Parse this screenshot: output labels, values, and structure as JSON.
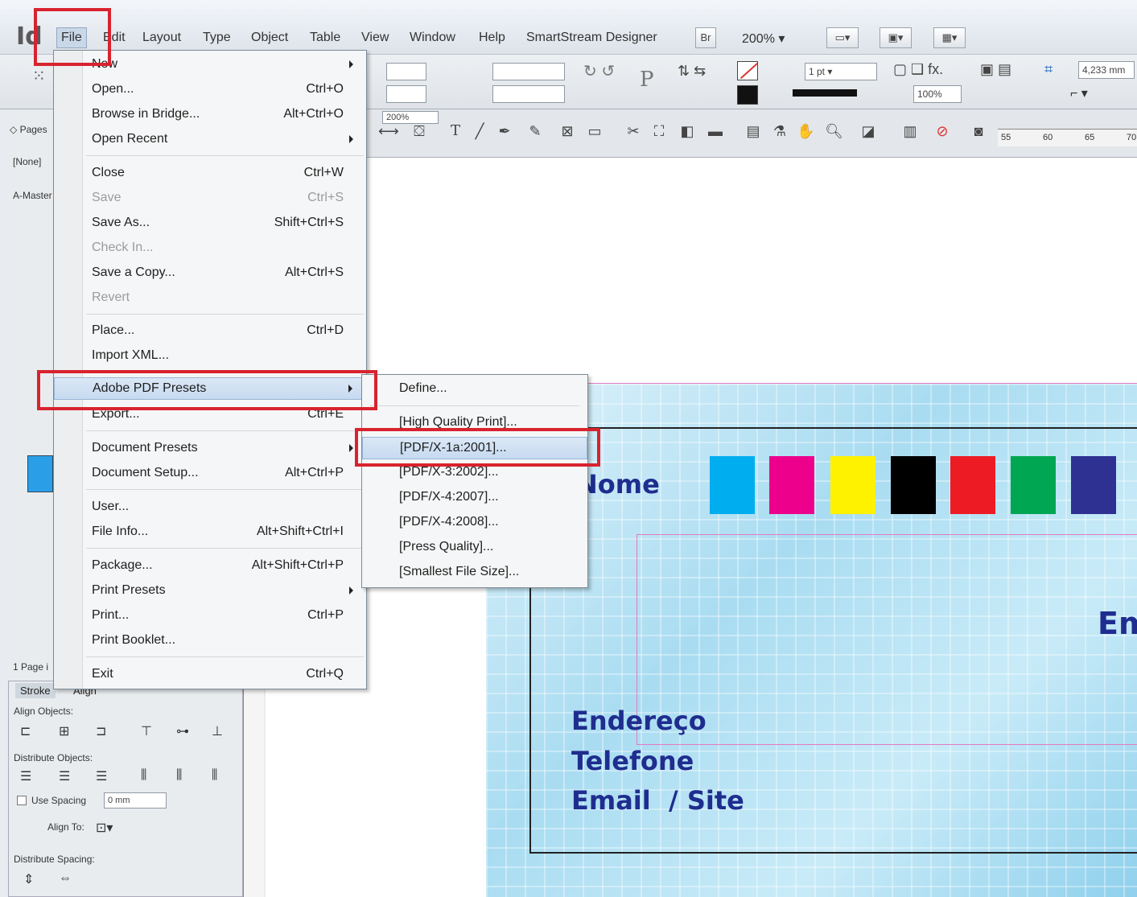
{
  "app": {
    "logo": "Id"
  },
  "menubar": {
    "items": [
      "File",
      "Edit",
      "Layout",
      "Type",
      "Object",
      "Table",
      "View",
      "Window",
      "Help",
      "SmartStream Designer"
    ],
    "bridge_btn": "Br",
    "zoom": "200%"
  },
  "control_bar": {
    "stroke_weight": "1 pt",
    "opacity": "100%",
    "size_value": "4,233 mm",
    "zoom_field": "200%"
  },
  "rulers": {
    "h_ticks": [
      "55",
      "60",
      "65",
      "70"
    ]
  },
  "pages_panel": {
    "tab": "Pages",
    "none_label": "[None]",
    "master_label": "A-Master",
    "footer": "1 Page i"
  },
  "align_panel": {
    "tab_stroke": "Stroke",
    "tab_align": "Align",
    "align_objects": "Align Objects:",
    "distribute_objects": "Distribute Objects:",
    "use_spacing": "Use Spacing",
    "spacing_value": "0 mm",
    "align_to": "Align To:",
    "distribute_spacing": "Distribute Spacing:"
  },
  "file_menu": {
    "items": [
      {
        "label": "New",
        "shortcut": "",
        "submenu": true
      },
      {
        "label": "Open...",
        "shortcut": "Ctrl+O"
      },
      {
        "label": "Browse in Bridge...",
        "shortcut": "Alt+Ctrl+O"
      },
      {
        "label": "Open Recent",
        "shortcut": "",
        "submenu": true
      },
      {
        "label": "Close",
        "shortcut": "Ctrl+W"
      },
      {
        "label": "Save",
        "shortcut": "Ctrl+S",
        "disabled": true
      },
      {
        "label": "Save As...",
        "shortcut": "Shift+Ctrl+S"
      },
      {
        "label": "Check In...",
        "shortcut": "",
        "disabled": true
      },
      {
        "label": "Save a Copy...",
        "shortcut": "Alt+Ctrl+S"
      },
      {
        "label": "Revert",
        "shortcut": "",
        "disabled": true
      },
      {
        "label": "Place...",
        "shortcut": "Ctrl+D"
      },
      {
        "label": "Import XML...",
        "shortcut": ""
      },
      {
        "label": "Adobe PDF Presets",
        "shortcut": "",
        "submenu": true,
        "highlighted": true
      },
      {
        "label": "Export...",
        "shortcut": "Ctrl+E"
      },
      {
        "label": "Document Presets",
        "shortcut": "",
        "submenu": true
      },
      {
        "label": "Document Setup...",
        "shortcut": "Alt+Ctrl+P"
      },
      {
        "label": "User...",
        "shortcut": ""
      },
      {
        "label": "File Info...",
        "shortcut": "Alt+Shift+Ctrl+I"
      },
      {
        "label": "Package...",
        "shortcut": "Alt+Shift+Ctrl+P"
      },
      {
        "label": "Print Presets",
        "shortcut": "",
        "submenu": true
      },
      {
        "label": "Print...",
        "shortcut": "Ctrl+P"
      },
      {
        "label": "Print Booklet...",
        "shortcut": ""
      },
      {
        "label": "Exit",
        "shortcut": "Ctrl+Q"
      }
    ]
  },
  "pdf_presets_submenu": {
    "items": [
      {
        "label": "Define..."
      },
      {
        "label": "[High Quality Print]..."
      },
      {
        "label": "[PDF/X-1a:2001]...",
        "highlighted": true
      },
      {
        "label": "[PDF/X-3:2002]..."
      },
      {
        "label": "[PDF/X-4:2007]..."
      },
      {
        "label": "[PDF/X-4:2008]..."
      },
      {
        "label": "[Press Quality]..."
      },
      {
        "label": "[Smallest File Size]..."
      }
    ]
  },
  "card": {
    "name": "Nome",
    "company_fragment": "Em",
    "address": "Endereço",
    "phone": "Telefone",
    "email_site": "Email  / Site",
    "swatches": [
      "#00aeef",
      "#ec008c",
      "#fff200",
      "#000000",
      "#ed1c24",
      "#00a651",
      "#2e3192"
    ]
  },
  "colors": {
    "callout": "#d8232f",
    "menu_highlight": "#c6daf0",
    "card_text": "#1f2d8f"
  }
}
